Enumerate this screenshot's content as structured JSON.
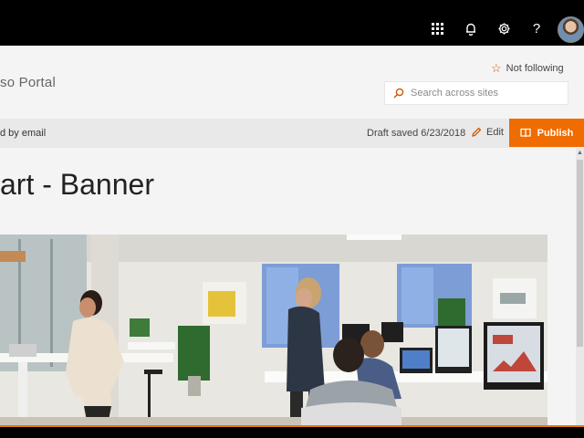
{
  "suite": {
    "icons": [
      "app-launcher-icon",
      "notification-bell-icon",
      "settings-gear-icon",
      "help-icon"
    ],
    "help_glyph": "?"
  },
  "site": {
    "title": "so Portal",
    "follow_label": "Not following",
    "search_placeholder": "Search across sites"
  },
  "command_bar": {
    "left_text": "d by email",
    "draft_status": "Draft saved 6/23/2018",
    "edit_label": "Edit",
    "publish_label": "Publish"
  },
  "page": {
    "title": "art - Banner"
  },
  "colors": {
    "accent": "#f06b00",
    "suite_bar": "#000000"
  }
}
